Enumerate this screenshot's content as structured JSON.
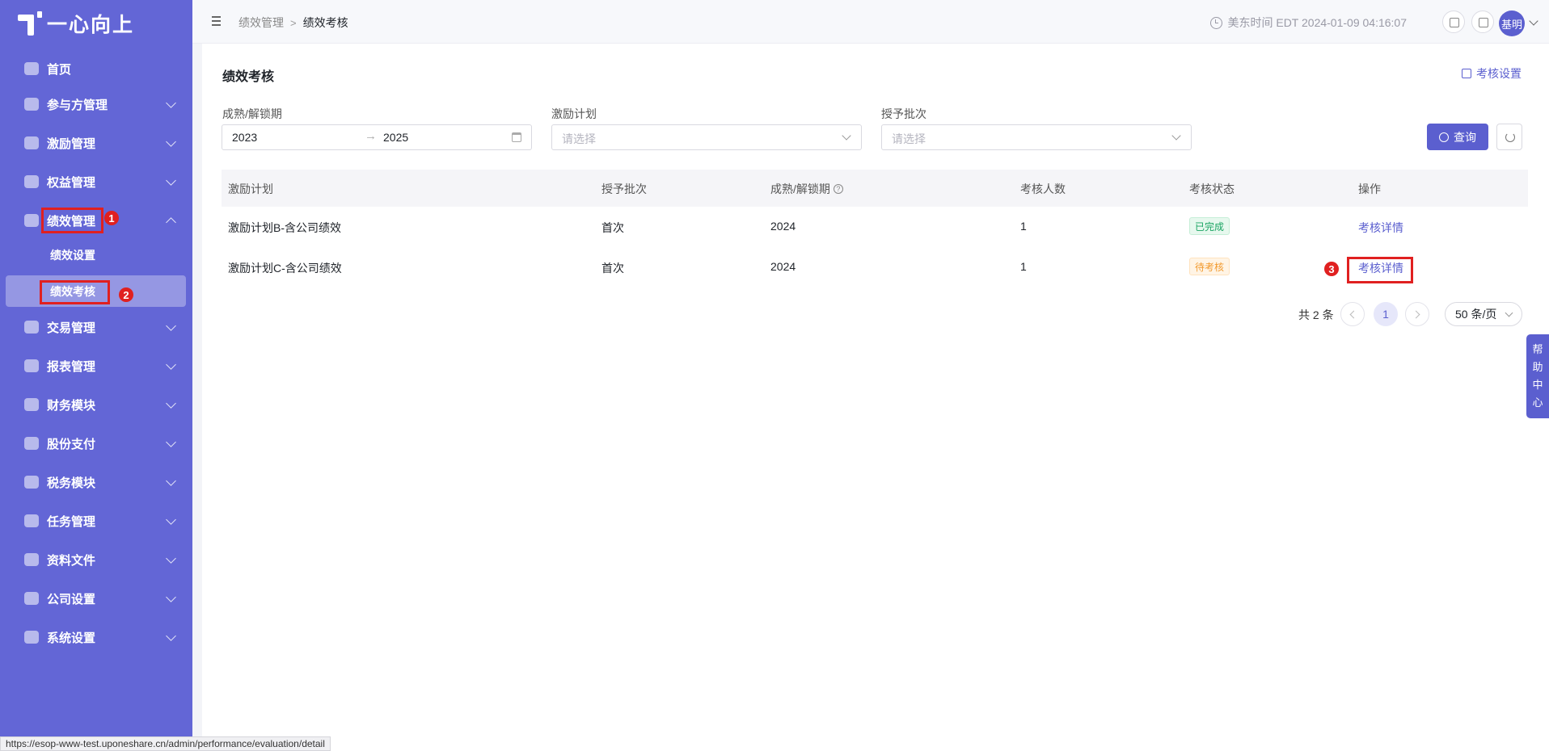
{
  "app": {
    "logo_text": "一心向上"
  },
  "sidebar": {
    "items": [
      {
        "label": "首页",
        "icon": "home-icon"
      },
      {
        "label": "参与方管理",
        "icon": "users-icon"
      },
      {
        "label": "激励管理",
        "icon": "incentive-icon"
      },
      {
        "label": "权益管理",
        "icon": "equity-icon"
      },
      {
        "label": "绩效管理",
        "icon": "crown-icon"
      },
      {
        "label": "交易管理",
        "icon": "trade-icon"
      },
      {
        "label": "报表管理",
        "icon": "report-icon"
      },
      {
        "label": "财务模块",
        "icon": "finance-icon"
      },
      {
        "label": "股份支付",
        "icon": "payment-icon"
      },
      {
        "label": "税务模块",
        "icon": "tax-icon"
      },
      {
        "label": "任务管理",
        "icon": "task-icon"
      },
      {
        "label": "资料文件",
        "icon": "folder-icon"
      },
      {
        "label": "公司设置",
        "icon": "company-icon"
      },
      {
        "label": "系统设置",
        "icon": "system-icon"
      }
    ],
    "sub_items": [
      {
        "label": "绩效设置"
      },
      {
        "label": "绩效考核"
      }
    ]
  },
  "annotations": [
    "1",
    "2",
    "3"
  ],
  "topbar": {
    "breadcrumb": [
      "绩效管理",
      "绩效考核"
    ],
    "breadcrumb_sep": ">",
    "time": "美东时间 EDT 2024-01-09 04:16:07",
    "user": "基明"
  },
  "page": {
    "title": "绩效考核",
    "settings_link": "考核设置"
  },
  "filters": {
    "period_label": "成熟/解锁期",
    "period_start": "2023",
    "period_arrow": "→",
    "period_end": "2025",
    "plan_label": "激励计划",
    "plan_placeholder": "请选择",
    "batch_label": "授予批次",
    "batch_placeholder": "请选择",
    "query_button": "查询"
  },
  "table": {
    "columns": [
      "激励计划",
      "授予批次",
      "成熟/解锁期",
      "考核人数",
      "考核状态",
      "操作"
    ],
    "rows": [
      {
        "plan": "激励计划B-含公司绩效",
        "batch": "首次",
        "period": "2024",
        "count": "1",
        "status": "已完成",
        "action": "考核详情"
      },
      {
        "plan": "激励计划C-含公司绩效",
        "batch": "首次",
        "period": "2024",
        "count": "1",
        "status": "待考核",
        "action": "考核详情"
      }
    ]
  },
  "pagination": {
    "total": "共 2 条",
    "current_page": "1",
    "page_size": "50 条/页"
  },
  "help_tab": [
    "帮",
    "助",
    "中",
    "心"
  ],
  "status_url": "https://esop-www-test.uponeshare.cn/admin/performance/evaluation/detail",
  "colors": {
    "primary": "#5b5fcf",
    "sidebar": "#6366d6",
    "annotation": "#e02020",
    "done": "#1aa462",
    "pending": "#f29a2e"
  }
}
